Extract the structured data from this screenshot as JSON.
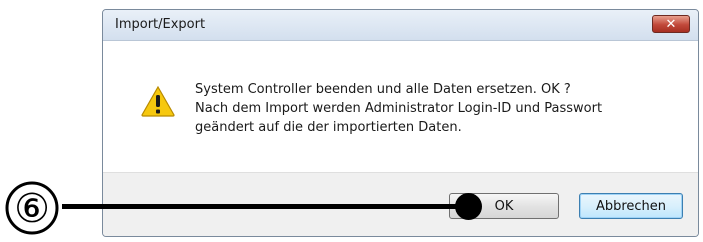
{
  "dialog": {
    "title": "Import/Export",
    "close_glyph": "✕",
    "icon": "warning-icon",
    "message_lines": [
      "System Controller beenden und alle Daten ersetzen. OK ?",
      "Nach dem Import werden Administrator Login-ID und Passwort",
      "geändert auf die der importierten Daten."
    ],
    "ok_label": "OK",
    "cancel_label": "Abbrechen"
  },
  "annotation": {
    "step_number": "⑥"
  },
  "colors": {
    "close_button": "#c1483a",
    "warning_yellow": "#f6c80f",
    "focus_border": "#3c7fb1"
  }
}
